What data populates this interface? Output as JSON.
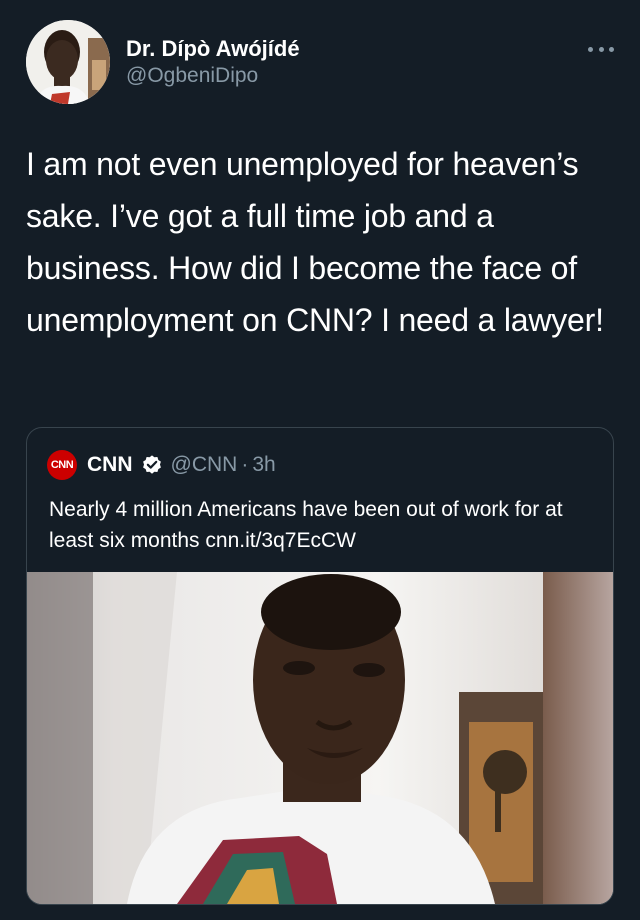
{
  "author": {
    "display_name": "Dr. Dípò Awójídé",
    "handle": "@OgbeniDipo"
  },
  "tweet": {
    "text": "I am not even unemployed for heaven’s sake. I’ve got a full time job and a business. How did I become the face of unemployment on CNN? I need a lawyer!"
  },
  "quoted_tweet": {
    "logo_text": "CNN",
    "name": "CNN",
    "handle": "@CNN",
    "separator": "·",
    "time": "3h",
    "text": "Nearly 4 million Americans have been out of work for at least six months cnn.it/3q7EcCW"
  },
  "icons": {
    "more": "more-horizontal-icon",
    "verified": "verified-badge-icon"
  },
  "colors": {
    "background": "#141d26",
    "secondary_text": "#8899a6",
    "border": "#38444d",
    "cnn_red": "#cc0000"
  }
}
